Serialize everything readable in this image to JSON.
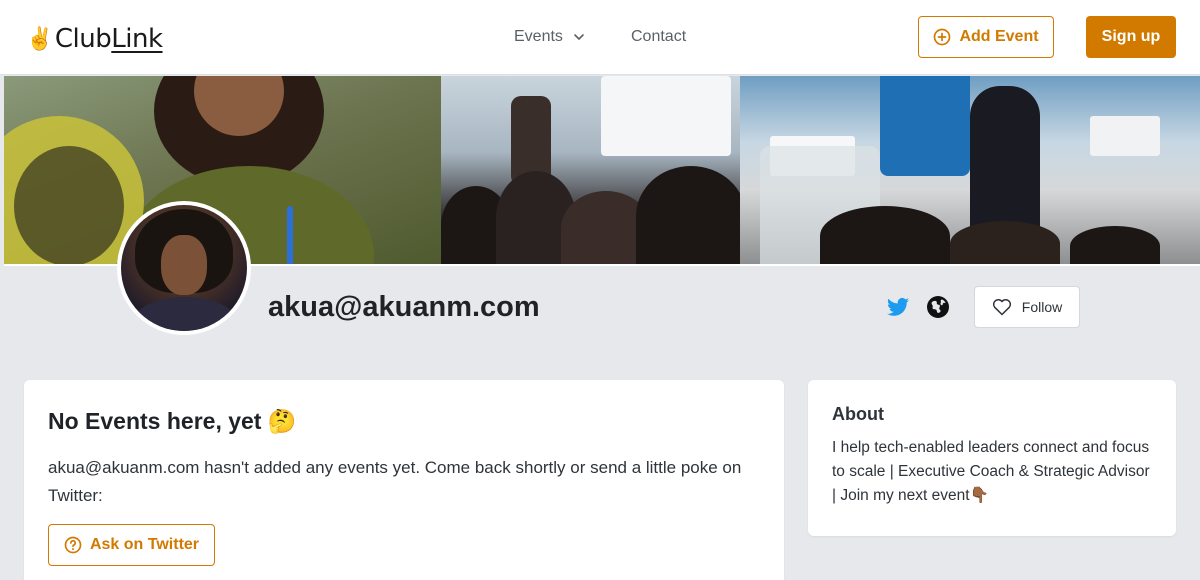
{
  "header": {
    "logo_prefix": "Club",
    "logo_suffix": "Link",
    "nav": {
      "events_label": "Events",
      "contact_label": "Contact"
    },
    "add_event_label": "Add Event",
    "signup_label": "Sign up"
  },
  "profile": {
    "name": "akua@akuanm.com",
    "follow_label": "Follow"
  },
  "events_card": {
    "title": "No Events here, yet 🤔",
    "body": "akua@akuanm.com hasn't added any events yet. Come back shortly or send a little poke on Twitter:",
    "ask_label": "Ask on Twitter"
  },
  "about_card": {
    "title": "About",
    "body": "I help tech-enabled leaders connect and focus to scale | Executive Coach & Strategic Advisor | Join my next event👇🏾"
  },
  "colors": {
    "accent": "#d27a00",
    "page_background": "#e6e8ec",
    "twitter_blue": "#1d9bf0"
  },
  "icons": {
    "logo": "victory-hand-icon",
    "events_dropdown": "chevron-down-icon",
    "add_event": "plus-circle-icon",
    "twitter": "twitter-icon",
    "website": "globe-icon",
    "follow": "heart-icon",
    "ask": "question-circle-icon"
  }
}
